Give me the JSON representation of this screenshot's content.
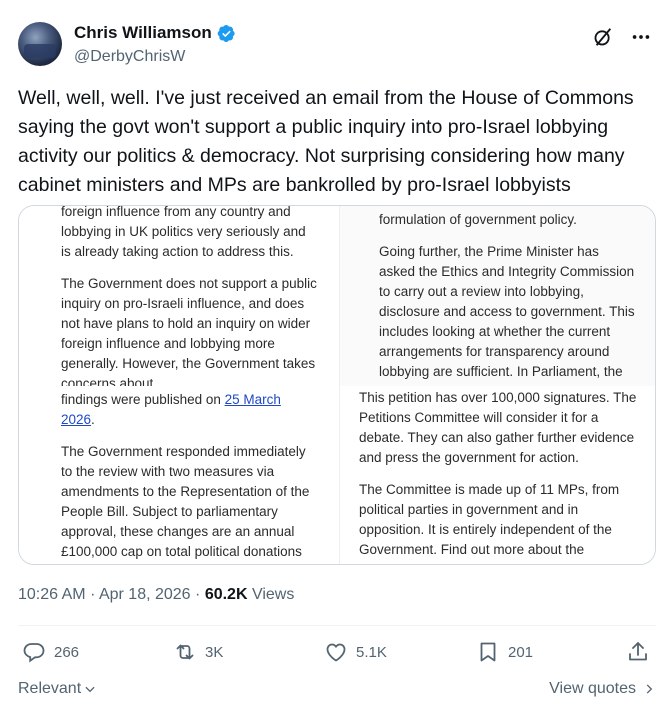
{
  "author": {
    "display_name": "Chris Williamson",
    "handle": "@DerbyChrisW",
    "verified": true
  },
  "tweet": {
    "text": "Well, well, well. I've just received an email from the House of Commons saying the govt won't support a public inquiry into pro-Israel lobbying activity our politics & democracy. Not surprising considering how many cabinet ministers and MPs are bankrolled by pro-Israel lobbyists"
  },
  "media": {
    "top_left": {
      "p1": "foreign influence from any country and lobbying in UK politics very seriously and is already taking action to address this.",
      "p2": "The Government does not support a public inquiry on pro-Israeli influence, and does not have plans to hold an inquiry on wider foreign influence and lobbying more generally. However, the Government takes concerns about"
    },
    "top_right": {
      "p1": "formulation of government policy.",
      "p2": "Going further, the Prime Minister has asked the Ethics and Integrity Commission to carry out a review into lobbying, disclosure and access to government. This includes looking at whether the current arrangements for transparency around lobbying are sufficient. In Parliament, the Government"
    },
    "bottom_left": {
      "p1_prefix": "findings were published on ",
      "p1_link": "25 March 2026",
      "p1_suffix": ".",
      "p2": "The Government responded immediately to the review with two measures via amendments to the Representation of the People Bill. Subject to parliamentary approval, these changes are an annual £100,000 cap on total political donations and a clampdown on the use of shell"
    },
    "bottom_right": {
      "p1": "This petition has over 100,000 signatures. The Petitions Committee will consider it for a debate. They can also gather further evidence and press the government for action.",
      "p2": "The Committee is made up of 11 MPs, from political parties in government and in opposition. It is entirely independent of the Government. Find out more about the Committee:"
    }
  },
  "meta": {
    "time": "10:26 AM",
    "separator": "·",
    "date": "Apr 18, 2026",
    "views_count": "60.2K",
    "views_label": "Views"
  },
  "actions": {
    "replies": "266",
    "reposts": "3K",
    "likes": "5.1K",
    "bookmarks": "201"
  },
  "footer": {
    "sort_label": "Relevant",
    "view_quotes_label": "View quotes"
  },
  "icons": {
    "verified": "verified-badge-icon",
    "grok": "grok-icon",
    "more": "more-icon",
    "reply": "reply-icon",
    "repost": "repost-icon",
    "like": "like-icon",
    "bookmark": "bookmark-icon",
    "share": "share-icon"
  },
  "colors": {
    "verified": "#1d9bf0",
    "secondary_text": "#536471",
    "link": "#1f48c7",
    "border": "#cfd9de"
  }
}
